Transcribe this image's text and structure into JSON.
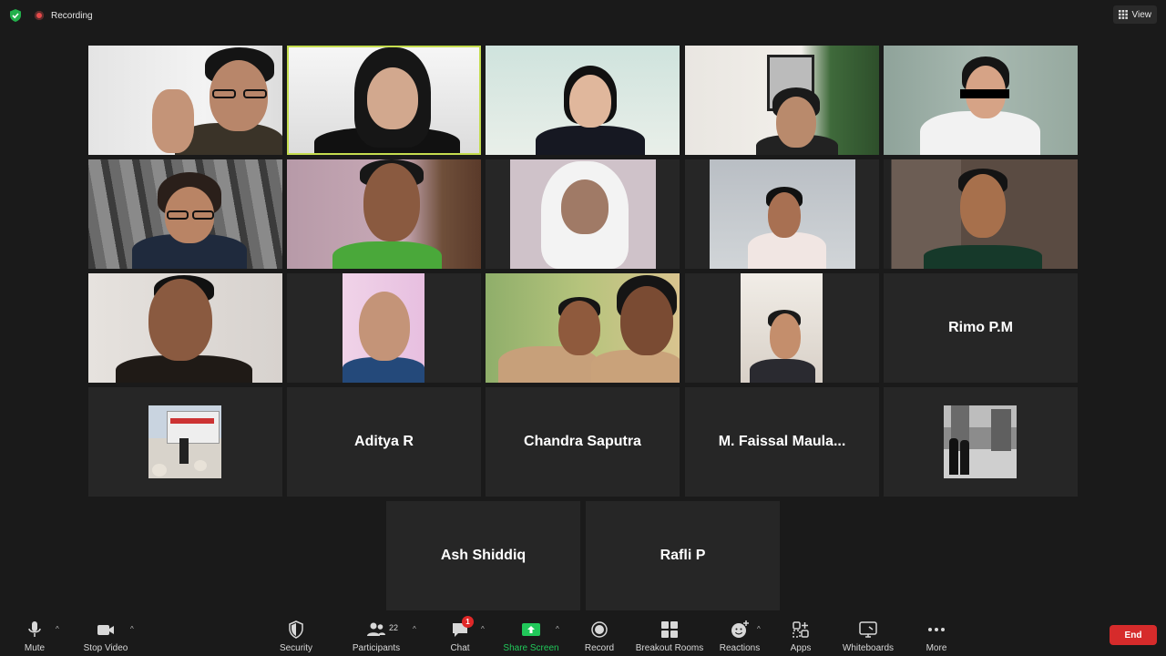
{
  "topbar": {
    "recording_label": "Recording",
    "view_label": "View"
  },
  "participants_named": {
    "rimo": "Rimo P.M",
    "aditya": "Aditya R",
    "chandra": "Chandra Saputra",
    "faissal": "M. Faissal Maula...",
    "ash": "Ash Shiddiq",
    "rafli": "Rafli P"
  },
  "toolbar": {
    "mute": "Mute",
    "stop_video": "Stop Video",
    "security": "Security",
    "participants": "Participants",
    "participants_count": "22",
    "chat": "Chat",
    "chat_badge": "1",
    "share_screen": "Share Screen",
    "record": "Record",
    "breakout_rooms": "Breakout Rooms",
    "reactions": "Reactions",
    "apps": "Apps",
    "whiteboards": "Whiteboards",
    "more": "More",
    "end": "End"
  },
  "colors": {
    "background": "#1a1a1a",
    "tile": "#262626",
    "speaker_border": "#c5dd4f",
    "share_green": "#21c85a",
    "end_red": "#d62b2b"
  }
}
